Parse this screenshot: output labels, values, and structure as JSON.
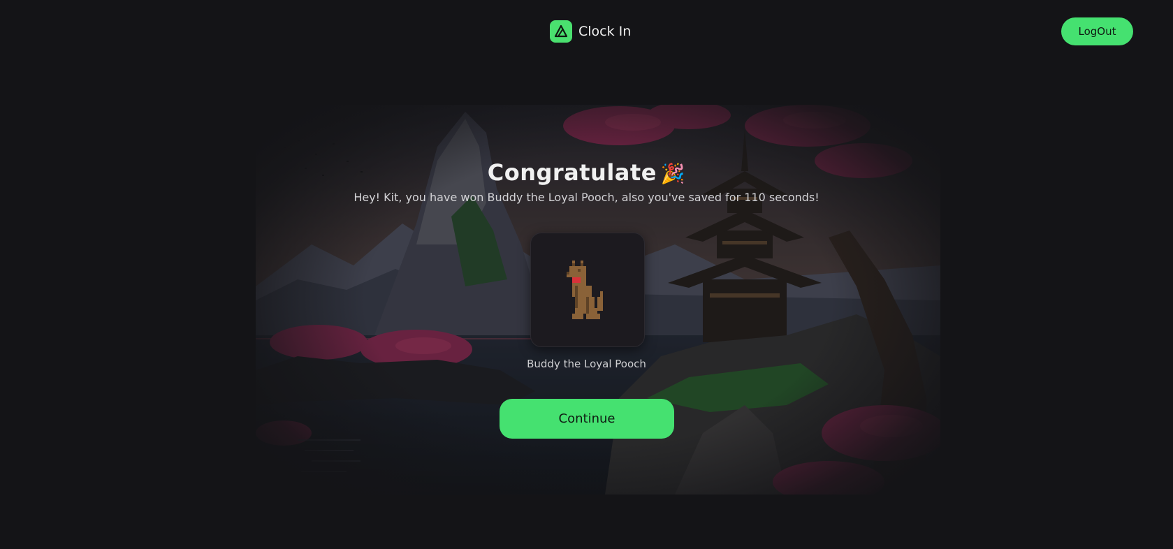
{
  "app": {
    "title": "Clock In",
    "logout_label": "LogOut"
  },
  "main": {
    "heading": "Congratulate",
    "heading_emoji": "🎉",
    "subtitle": "Hey! Kit, you have won Buddy the Loyal Pooch, also you've saved for 110 seconds!",
    "reward": {
      "name": "Buddy the Loyal Pooch",
      "icon": "dog-icon"
    },
    "continue_label": "Continue"
  },
  "colors": {
    "background": "#141417",
    "accent": "#45e170"
  }
}
